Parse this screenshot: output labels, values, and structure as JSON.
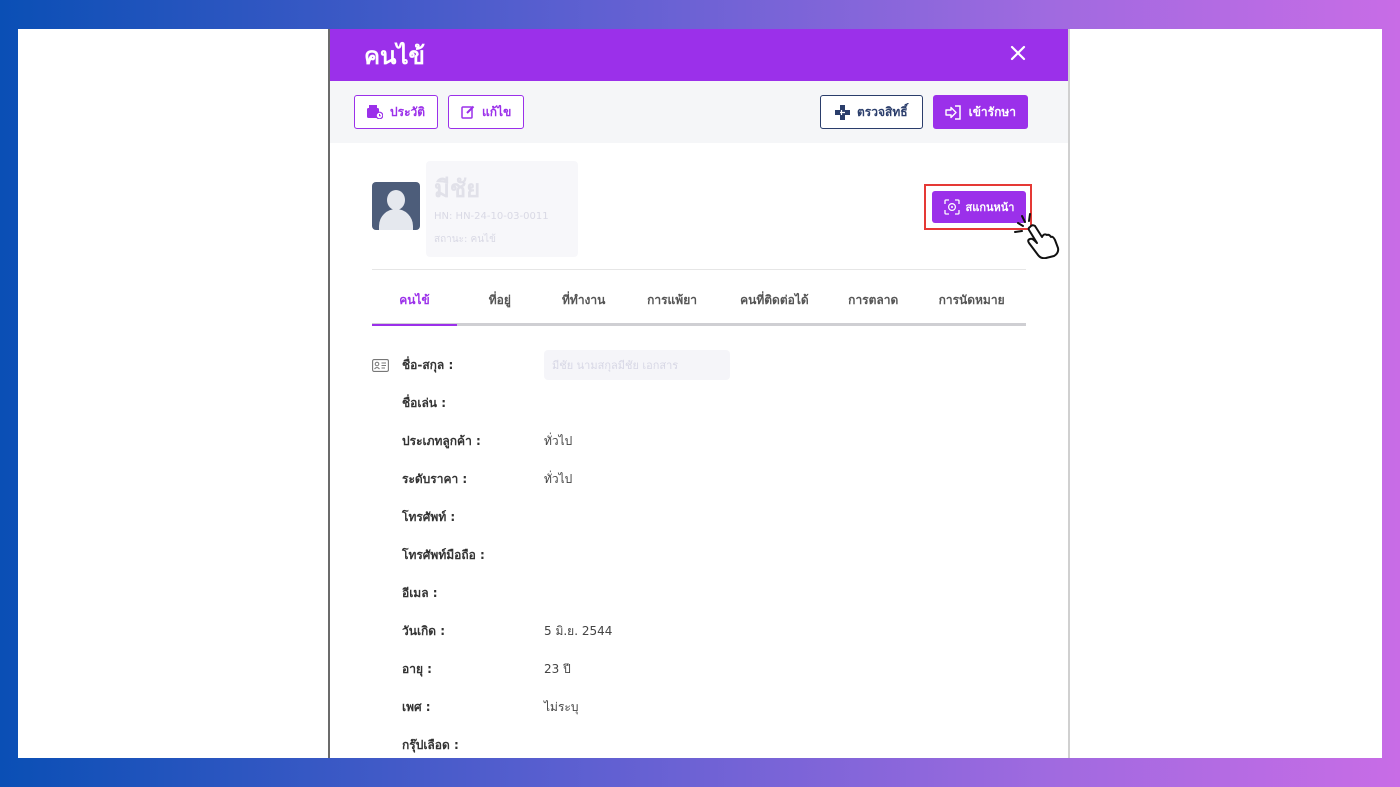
{
  "modal": {
    "title": "คนไข้",
    "close_icon": "close-icon"
  },
  "toolbar": {
    "history_label": "ประวัติ",
    "edit_label": "แก้ไข",
    "check_rights_label": "ตรวจสิทธิ์",
    "admit_label": "เข้ารักษา"
  },
  "profile": {
    "name": "มีชัย",
    "hn": "HN: HN-24-10-03-0011",
    "status": "สถานะ: คนไข้",
    "scan_face_label": "สแกนหน้า"
  },
  "tabs": [
    {
      "label": "คนไข้",
      "active": true
    },
    {
      "label": "ที่อยู่",
      "active": false
    },
    {
      "label": "ที่ทำงาน",
      "active": false
    },
    {
      "label": "การแพ้ยา",
      "active": false
    },
    {
      "label": "คนที่ติดต่อได้",
      "active": false
    },
    {
      "label": "การตลาด",
      "active": false
    },
    {
      "label": "การนัดหมาย",
      "active": false
    }
  ],
  "details": [
    {
      "label": "ชื่อ-สกุล :",
      "value": "มีชัย นามสกุลมีชัย เอกสาร"
    },
    {
      "label": "ชื่อเล่น :",
      "value": ""
    },
    {
      "label": "ประเภทลูกค้า :",
      "value": "ทั่วไป"
    },
    {
      "label": "ระดับราคา :",
      "value": "ทั่วไป"
    },
    {
      "label": "โทรศัพท์ :",
      "value": ""
    },
    {
      "label": "โทรศัพท์มือถือ :",
      "value": ""
    },
    {
      "label": "อีเมล :",
      "value": ""
    },
    {
      "label": "วันเกิด :",
      "value": "5 มิ.ย. 2544"
    },
    {
      "label": "อายุ :",
      "value": "23 ปี"
    },
    {
      "label": "เพศ :",
      "value": "ไม่ระบุ"
    },
    {
      "label": "กรุ๊ปเลือด :",
      "value": ""
    }
  ],
  "colors": {
    "primary": "#9b30ea",
    "navy": "#2a3d6b",
    "highlight": "#e53935"
  }
}
